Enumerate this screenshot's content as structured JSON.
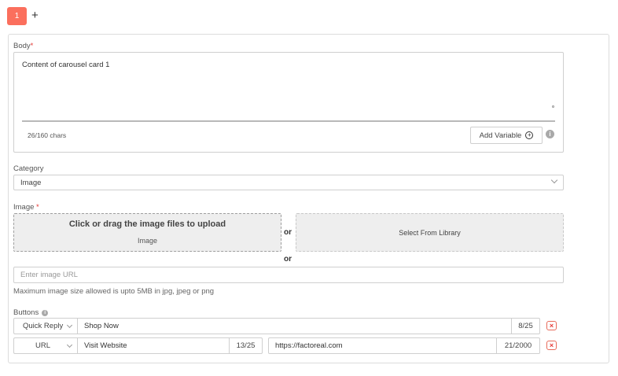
{
  "tabs": {
    "active_label": "1",
    "add_label": "+"
  },
  "body": {
    "label": "Body",
    "required_mark": "*",
    "value": "Content of carousel card 1",
    "char_count": "26/160 chars",
    "add_variable_label": "Add Variable"
  },
  "category": {
    "label": "Category",
    "selected": "Image"
  },
  "image": {
    "label": "Image ",
    "required_mark": "*",
    "upload_title": "Click or drag the image files to upload",
    "upload_subtitle": "Image",
    "or_label": "or",
    "library_label": "Select From Library",
    "url_placeholder": "Enter image URL",
    "hint": "Maximum image size allowed is upto 5MB in jpg, jpeg or png"
  },
  "buttons": {
    "label": "Buttons",
    "rows": [
      {
        "type": "Quick Reply",
        "text": "Shop Now",
        "text_count": "8/25"
      },
      {
        "type": "URL",
        "text": "Visit Website",
        "text_count": "13/25",
        "url": "https://factoreal.com",
        "url_count": "21/2000"
      }
    ]
  },
  "colors": {
    "accent": "#fb6f5d",
    "danger": "#e53935"
  }
}
